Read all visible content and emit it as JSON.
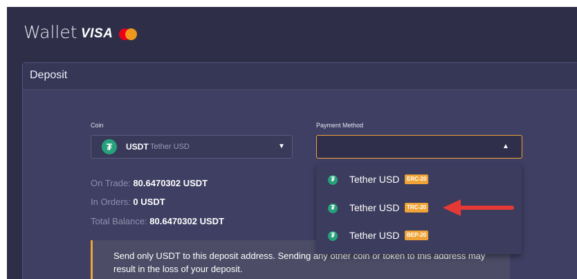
{
  "header": {
    "title": "Wallet",
    "visa": "VISA"
  },
  "deposit": {
    "title": "Deposit"
  },
  "coin": {
    "label": "Coin",
    "symbol": "USDT",
    "name": "Tether USD"
  },
  "payment": {
    "label": "Payment Method",
    "options": [
      {
        "label": "Tether USD",
        "badge": "ERC-20"
      },
      {
        "label": "Tether USD",
        "badge": "TRC-20"
      },
      {
        "label": "Tether USD",
        "badge": "BEP-20"
      }
    ]
  },
  "balances": {
    "on_trade_label": "On Trade:",
    "on_trade_value": "80.6470302 USDT",
    "in_orders_label": "In Orders:",
    "in_orders_value": "0 USDT",
    "total_label": "Total Balance:",
    "total_value": "80.6470302 USDT"
  },
  "notice": {
    "text": "Send only USDT to this deposit address. Sending any other coin or token to this address may result in the loss of your deposit."
  },
  "icons": {
    "coin": "tether-icon",
    "coin_caret": "caret-down-icon",
    "payment_caret": "caret-up-icon",
    "pointer": "red-arrow-icon"
  },
  "colors": {
    "accent": "#f0a437",
    "tether": "#26a17b",
    "arrow": "#e53935",
    "mastercard_red": "#eb001b",
    "mastercard_orange": "#f79e1b"
  }
}
